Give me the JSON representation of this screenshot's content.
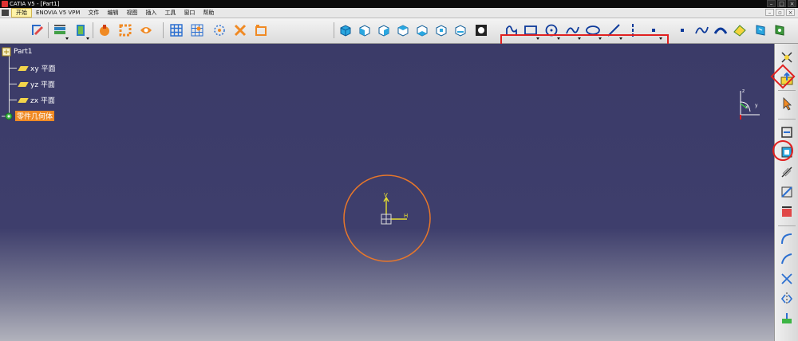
{
  "window": {
    "title": "CATIA V5 - [Part1]"
  },
  "menu": {
    "items": [
      "开始",
      "ENOVIA V5 VPM",
      "文件",
      "编辑",
      "视图",
      "插入",
      "工具",
      "窗口",
      "帮助"
    ]
  },
  "tree": {
    "root": "Part1",
    "planes": [
      "xy 平面",
      "yz 平面",
      "zx 平面"
    ],
    "body": "零件几何体"
  },
  "viewport": {
    "axis_labels": {
      "v": "V",
      "h": "H"
    },
    "compass_labels": {
      "z": "z",
      "x": "x",
      "y": "y"
    }
  },
  "colors": {
    "background": "#3a3a66",
    "sketch_circle": "#e8772a",
    "highlight": "#e02020",
    "axis": "#e8e030"
  },
  "icons": {
    "toolbar": [
      "sketcher-icon",
      "operation-icon",
      "pad-icon",
      "pocket-icon",
      "shaft-icon",
      "hole-icon",
      "grid-icon",
      "snap-icon",
      "construction-icon",
      "dimension-icon",
      "iso-view-icon",
      "front-view-icon",
      "back-view-icon",
      "left-view-icon",
      "right-view-icon",
      "top-view-icon",
      "bottom-view-icon",
      "shading-icon",
      "profile-icon",
      "rectangle-icon",
      "circle-icon",
      "spline-icon",
      "ellipse-icon",
      "line-icon",
      "axis-icon",
      "point-icon",
      "point-small-icon",
      "curve-icon",
      "conic-icon",
      "surface-icon",
      "view-normal-icon",
      "view-rotate-icon"
    ],
    "rightbar": [
      "compass-icon",
      "exit-workbench-icon",
      "select-arrow-icon",
      "constraint-icon",
      "constraint-box-icon",
      "dimension-tool-icon",
      "fix-icon",
      "auto-constraint-icon",
      "corner-icon",
      "chamfer-icon",
      "trim-icon",
      "mirror-icon",
      "project-icon"
    ]
  }
}
